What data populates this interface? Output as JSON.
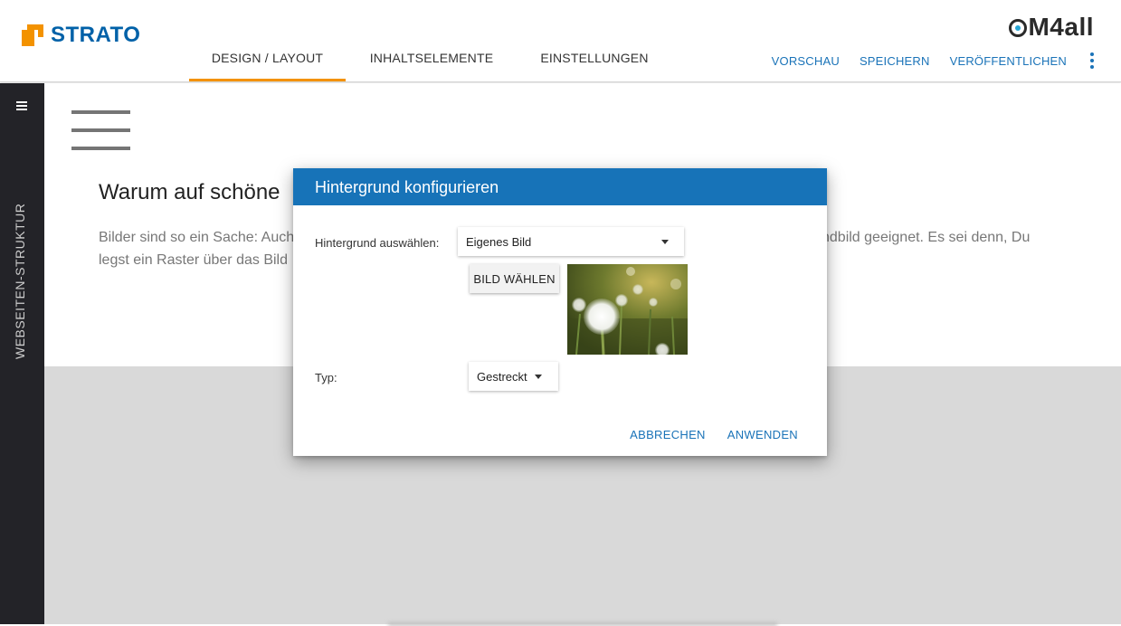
{
  "header": {
    "brand": "STRATO",
    "product_logo": {
      "prefix": "C",
      "suffix": "M4all"
    },
    "tabs": [
      {
        "label": "DESIGN / LAYOUT",
        "active": true
      },
      {
        "label": "INHALTSELEMENTE",
        "active": false
      },
      {
        "label": "EINSTELLUNGEN",
        "active": false
      }
    ],
    "actions": {
      "preview": "VORSCHAU",
      "save": "SPEICHERN",
      "publish": "VERÖFFENTLICHEN"
    },
    "more_icon": "kebab-menu-icon"
  },
  "sidebar": {
    "label": "WEBSEITEN-STRUKTUR",
    "menu_icon": "hamburger-icon"
  },
  "page": {
    "heading": "Warum auf schöne",
    "text_line1_left": "Bilder sind so ein Sache: Auch",
    "text_line1_right": "ndbild geeignet. Es sei denn, Du",
    "text_line2_left": "legst ein Raster über das Bild"
  },
  "dialog": {
    "title": "Hintergrund konfigurieren",
    "background_label": "Hintergrund auswählen:",
    "background_value": "Eigenes Bild",
    "choose_image_button": "BILD WÄHLEN",
    "type_label": "Typ:",
    "type_value": "Gestreckt",
    "cancel": "ABBRECHEN",
    "apply": "ANWENDEN"
  },
  "colors": {
    "brand_orange": "#f39200",
    "brand_blue": "#0061a8",
    "accent_blue": "#1773b8",
    "sidebar_dark": "#232328"
  }
}
